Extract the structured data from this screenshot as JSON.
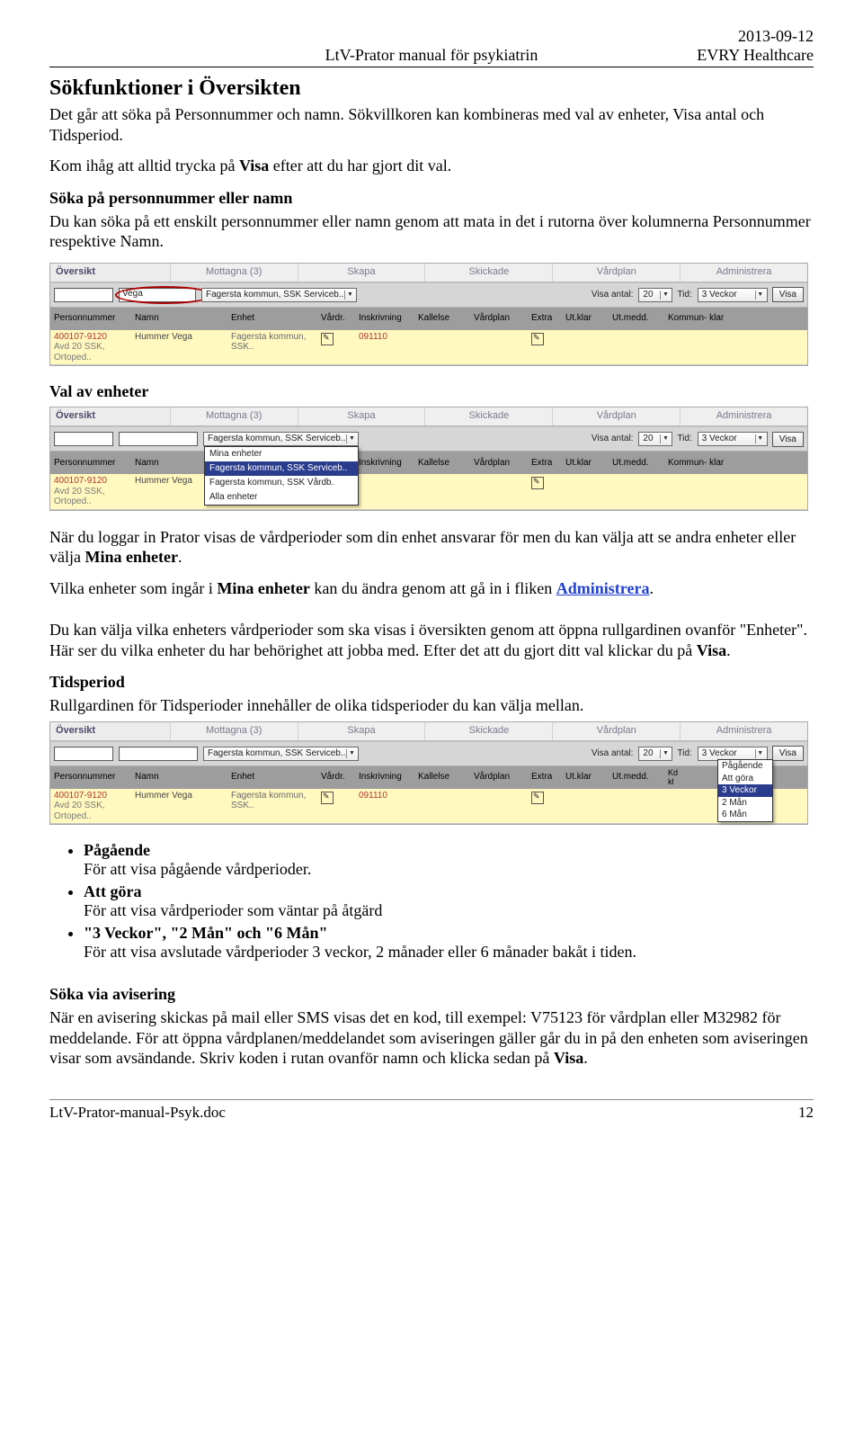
{
  "header": {
    "center": "LtV-Prator manual för psykiatrin",
    "date": "2013-09-12",
    "company": "EVRY Healthcare"
  },
  "h1": "Sökfunktioner i Översikten",
  "intro_p1": "Det går att söka på Personnummer och namn. Sökvillkoren kan kombineras med val av enheter, Visa antal och Tidsperiod.",
  "intro_p2a": "Kom ihåg att alltid trycka på ",
  "intro_p2b": "Visa",
  "intro_p2c": " efter att du har gjort dit val.",
  "sub1": "Söka på personnummer eller namn",
  "sub1_text": "Du kan söka på ett enskilt personnummer eller namn genom att mata in det i rutorna över kolumnerna Personnummer respektive Namn.",
  "shot": {
    "tabs": [
      "Översikt",
      "Mottagna (3)",
      "Skapa",
      "Skickade",
      "Vårdplan",
      "Administrera"
    ],
    "filter": {
      "vega": "Vega",
      "enhet_sel": "Fagersta kommun, SSK Serviceb..",
      "visa_antal_label": "Visa antal:",
      "visa_antal_val": "20",
      "tid_label": "Tid:",
      "tid_sel": "3 Veckor",
      "btn": "Visa"
    },
    "grid_headers": [
      "Personnummer",
      "Namn",
      "Enhet",
      "Vårdr.",
      "Inskrivning",
      "Kallelse",
      "Vårdplan",
      "Extra",
      "Ut.klar",
      "Ut.medd.",
      "Kommun- klar"
    ],
    "row": {
      "pnr": "400107-9120",
      "name": "Hummer Vega",
      "sub": "Avd 20 SSK, Ortoped..",
      "enhet": "Fagersta kommun, SSK..",
      "inskriv": "091110"
    }
  },
  "sub2": "Val av enheter",
  "shot2_dropdown": [
    "Mina enheter",
    "Fagersta kommun, SSK Serviceb..",
    "Fagersta kommun, SSK Vårdb.",
    "Alla enheter"
  ],
  "after_shot2_p1a": "När du loggar in Prator visas de vårdperioder som din enhet ansvarar för men du kan välja att se andra enheter eller välja ",
  "after_shot2_p1b": "Mina enheter",
  "after_shot2_p2a": "Vilka enheter som ingår i ",
  "after_shot2_p2b": "Mina enheter",
  "after_shot2_p2c": " kan du ändra genom att gå in i fliken ",
  "after_shot2_p2d": "Administrera",
  "after_shot2_p2e": ".",
  "p3": "Du kan välja vilka enheters vårdperioder som ska visas i översikten genom att öppna rullgardinen ovanför \"Enheter\". Här ser du vilka enheter du har behörighet att jobba med. Efter det att du gjort ditt val klickar du på ",
  "p3b": "Visa",
  "p3c": ".",
  "sub3": "Tidsperiod",
  "sub3_text": "Rullgardinen för Tidsperioder innehåller de olika tidsperioder du kan välja mellan.",
  "tid_dropdown": [
    "Pågående",
    "Att göra",
    "3 Veckor",
    "2 Mån",
    "6 Mån"
  ],
  "bullets": [
    {
      "title": "Pågående",
      "desc": "För att visa pågående vårdperioder."
    },
    {
      "title": "Att göra",
      "desc": "För att visa vårdperioder som väntar på åtgärd"
    },
    {
      "title": "\"3 Veckor\", \"2 Mån\"  och \"6 Mån\"",
      "desc": "För att visa avslutade vårdperioder 3 veckor, 2 månader eller 6 månader bakåt i tiden."
    }
  ],
  "sub4": "Söka via avisering",
  "sub4_text_a": "När en avisering skickas på mail eller SMS visas det en kod, till exempel: V75123 för vårdplan eller M32982 för meddelande. För att öppna vårdplanen/meddelandet som aviseringen gäller går du in på den enheten som aviseringen visar som avsändande. Skriv koden i rutan ovanför namn och klicka sedan på ",
  "sub4_text_b": "Visa",
  "sub4_text_c": ".",
  "footer": {
    "left": "LtV-Prator-manual-Psyk.doc",
    "right": "12"
  }
}
